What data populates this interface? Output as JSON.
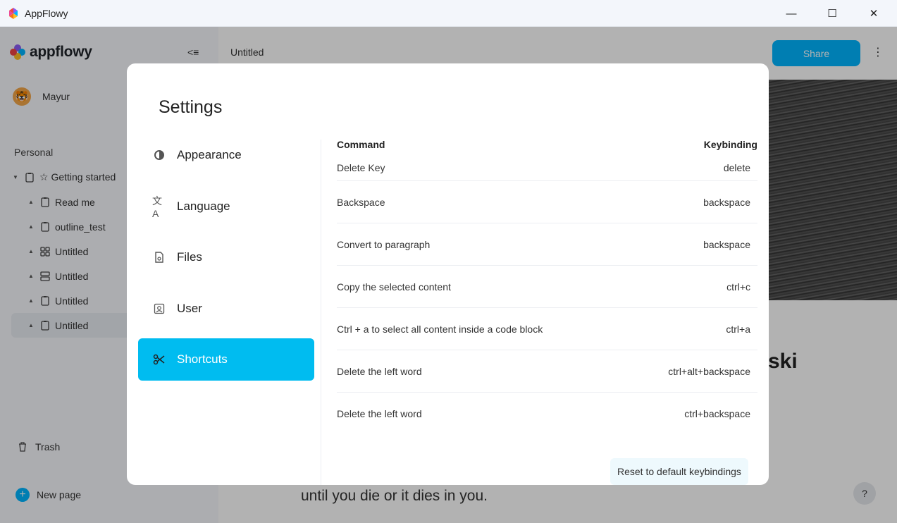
{
  "window": {
    "title": "AppFlowy",
    "minimize": "—",
    "maximize": "☐",
    "close": "✕"
  },
  "sidebar": {
    "brand": "appflowy",
    "user_name": "Mayur",
    "section_label": "Personal",
    "tree": [
      {
        "label": "☆ Getting started",
        "icon": "document-icon"
      },
      {
        "label": "Read me",
        "icon": "document-icon"
      },
      {
        "label": "outline_test",
        "icon": "document-icon"
      },
      {
        "label": "Untitled",
        "icon": "grid-icon"
      },
      {
        "label": "Untitled",
        "icon": "board-icon"
      },
      {
        "label": "Untitled",
        "icon": "document-icon"
      },
      {
        "label": "Untitled",
        "icon": "document-icon"
      }
    ],
    "trash_label": "Trash",
    "new_page_label": "New page"
  },
  "main": {
    "page_title": "Untitled",
    "share_label": "Share",
    "heading_fragment": "ski",
    "body_line": "until you die or it dies in you.",
    "help_label": "?"
  },
  "settings": {
    "title": "Settings",
    "nav": [
      {
        "label": "Appearance",
        "icon": "appearance-icon"
      },
      {
        "label": "Language",
        "icon": "language-icon"
      },
      {
        "label": "Files",
        "icon": "files-icon"
      },
      {
        "label": "User",
        "icon": "user-icon"
      },
      {
        "label": "Shortcuts",
        "icon": "scissors-icon"
      }
    ],
    "active_nav": "Shortcuts",
    "shortcuts": {
      "col_command": "Command",
      "col_keybinding": "Keybinding",
      "rows": [
        {
          "command": "Delete Key",
          "key": "delete"
        },
        {
          "command": "Backspace",
          "key": "backspace"
        },
        {
          "command": "Convert to paragraph",
          "key": "backspace"
        },
        {
          "command": "Copy the selected content",
          "key": "ctrl+c"
        },
        {
          "command": "Ctrl + a to select all content inside a code block",
          "key": "ctrl+a"
        },
        {
          "command": "Delete the left word",
          "key": "ctrl+alt+backspace"
        },
        {
          "command": "Delete the left word",
          "key": "ctrl+backspace"
        }
      ],
      "reset_label": "Reset to default keybindings"
    }
  },
  "colors": {
    "accent": "#00bcf0",
    "share": "#00b5ff"
  }
}
